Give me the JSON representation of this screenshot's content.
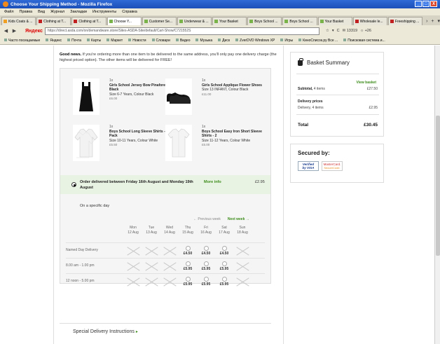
{
  "window": {
    "title": "Choose Your Shipping Method - Mozilla Firefox",
    "controls": [
      "_",
      "□",
      "X"
    ]
  },
  "menu": [
    "Файл",
    "Правка",
    "Вид",
    "Журнал",
    "Закладки",
    "Инструменты",
    "Справка"
  ],
  "tabs": [
    {
      "label": "Kids Coats & ...",
      "fav_color": "#f0a020"
    },
    {
      "label": "Clothing at T...",
      "fav_color": "#c02020"
    },
    {
      "label": "Clothing at T...",
      "fav_color": "#c02020"
    },
    {
      "label": "Choose Y...",
      "fav_color": "#7ab34a",
      "active": true
    },
    {
      "label": "Customer Se...",
      "fav_color": "#7ab34a"
    },
    {
      "label": "Underwear & ...",
      "fav_color": "#7ab34a"
    },
    {
      "label": "Your Basket",
      "fav_color": "#7ab34a"
    },
    {
      "label": "Boys School ...",
      "fav_color": "#7ab34a"
    },
    {
      "label": "Boys School ...",
      "fav_color": "#7ab34a"
    },
    {
      "label": "Your Basket",
      "fav_color": "#7ab34a"
    },
    {
      "label": "Wholesale le...",
      "fav_color": "#c02020"
    },
    {
      "label": "Freeshipping ...",
      "fav_color": "#c02020"
    }
  ],
  "tab_controls": [
    "›",
    "+",
    "▾"
  ],
  "nav": {
    "back": "◀",
    "forward": "▶",
    "search_engine": "Яндекс",
    "url": "https://direct.asda.com/on/demandware.store/Sites-ASDA-Site/default/Cart-Show/C721552S",
    "right_items": [
      "☆",
      "▾",
      "C",
      "✉ 13319",
      "☼ +26"
    ]
  },
  "bookmarks": [
    "Часто посещаемые",
    "Яндекс",
    "Почта",
    "Карты",
    "Маркет",
    "Новости",
    "Словари",
    "Видео",
    "Музыка",
    "Диск",
    "ZverDVD Windows XP",
    "Игры",
    "КиноСписок.ру Все ...",
    "Поисковая система и..."
  ],
  "notice": {
    "strong": "Good news.",
    "text": " If you're ordering more than one item to be delivered to the same address, you'll only pay one delivery charge (the highest priced option). The other items will be delivered for FREE!"
  },
  "products": [
    {
      "qty": "1x",
      "name": "Girls School Jersey Bow Pinafore - Black",
      "size": "Size 6-7 Years, Colour Black",
      "price": "£6.00",
      "icon": "pinafore-image"
    },
    {
      "qty": "1x",
      "name": "Girls School Applique Flower Shoes",
      "size": "Size 13 INFANT, Colour Black",
      "price": "£11.00",
      "icon": "shoes-image"
    },
    {
      "qty": "1x",
      "name": "Boys School Long Sleeve Shirts - 2 Pack",
      "size": "Size 10-11 Years, Colour White",
      "price": "£5.50",
      "icon": "long-sleeve-shirt-image"
    },
    {
      "qty": "1x",
      "name": "Boys School Easy Iron Short Sleeve Shirts - 2",
      "size": "Size 11-12 Years, Colour White",
      "price": "£5.00",
      "icon": "short-sleeve-shirt-image"
    }
  ],
  "delivery": {
    "option": "Order delivered between Friday 16th August and Monday 19th August",
    "more_info": "More info",
    "price": "£2.95",
    "specific_day": "On a specific day",
    "prev_week": "← Previous week",
    "next_week": "Next week →",
    "days": [
      {
        "day": "Mon",
        "date": "12 Aug"
      },
      {
        "day": "Tue",
        "date": "13 Aug"
      },
      {
        "day": "Wed",
        "date": "14 Aug"
      },
      {
        "day": "Thu",
        "date": "15 Aug"
      },
      {
        "day": "Fri",
        "date": "16 Aug"
      },
      {
        "day": "Sat",
        "date": "17 Aug"
      },
      {
        "day": "Sun",
        "date": "18 Aug"
      }
    ],
    "slots": [
      {
        "label": "Named Day Delivery",
        "prices": [
          null,
          null,
          null,
          "£4.50",
          "£4.50",
          "£4.50",
          null
        ]
      },
      {
        "label": "8.00 am - 1.00 pm",
        "prices": [
          null,
          null,
          null,
          "£5.95",
          "£5.95",
          "£5.95",
          null
        ]
      },
      {
        "label": "12 noon - 5.00 pm",
        "prices": [
          null,
          null,
          null,
          "£5.95",
          "£5.95",
          "£5.95",
          null
        ]
      }
    ]
  },
  "special_instructions": {
    "label": "Special Delivery Instructions",
    "arrow": "▸"
  },
  "basket": {
    "title": "Basket Summary",
    "view_link": "View basket",
    "subtotal_label": "Subtotal,",
    "subtotal_items": "4 items",
    "subtotal_value": "£27.50",
    "delivery_heading": "Delivery prices",
    "delivery_label": "Delivery, 4 items",
    "delivery_value": "£2.95",
    "total_label": "Total",
    "total_value": "£30.45"
  },
  "secured": {
    "title": "Secured by:",
    "vbv_line1": "Verified",
    "vbv_line2": "by VISA",
    "msc_line1": "MasterCard.",
    "msc_line2": "SecureCode."
  }
}
